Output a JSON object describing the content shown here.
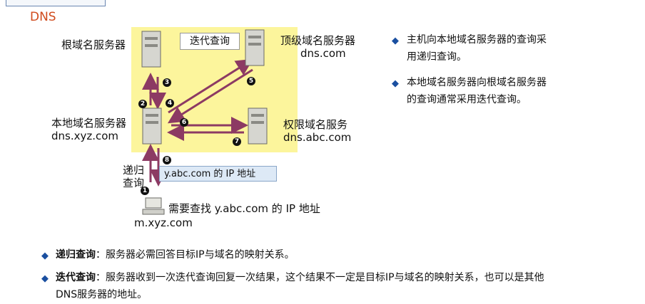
{
  "heading": "DNS",
  "diagram": {
    "title": "迭代查询",
    "root_server_label": "根域名服务器",
    "tld_server_label": "顶级域名服务器",
    "tld_server_domain": "dns.com",
    "local_server_label": "本地域名服务器",
    "local_server_domain": "dns.xyz.com",
    "auth_server_label": "权限域名服务",
    "auth_server_domain": "dns.abc.com",
    "recursive_label": "递归\n查询",
    "recursive_label_1": "递归",
    "recursive_label_2": "查询",
    "answer_box": "y.abc.com 的 IP 地址",
    "host_query": "需要查找 y.abc.com 的 IP 地址",
    "host_domain": "m.xyz.com",
    "steps": [
      "1",
      "2",
      "3",
      "4",
      "5",
      "6",
      "7",
      "8"
    ]
  },
  "side_notes": [
    "主机向本地域名服务器的查询采用递归查询。",
    "本地域名服务器向根域名服务器的查询通常采用迭代查询。"
  ],
  "bottom_bullets": [
    {
      "term": "递归查询",
      "text": "：服务器必需回答目标IP与域名的映射关系。"
    },
    {
      "term": "迭代查询",
      "text": "：服务器收到一次迭代查询回复一次结果，这个结果不一定是目标IP与域名的映射关系，也可以是其他DNS服务器的地址。"
    }
  ],
  "colors": {
    "accent": "#d04a1c",
    "diagram_bg": "#fcf59c",
    "arrow": "#8c3a63",
    "bullet": "#1a4fa0",
    "answer_bg": "#dde9f6"
  }
}
